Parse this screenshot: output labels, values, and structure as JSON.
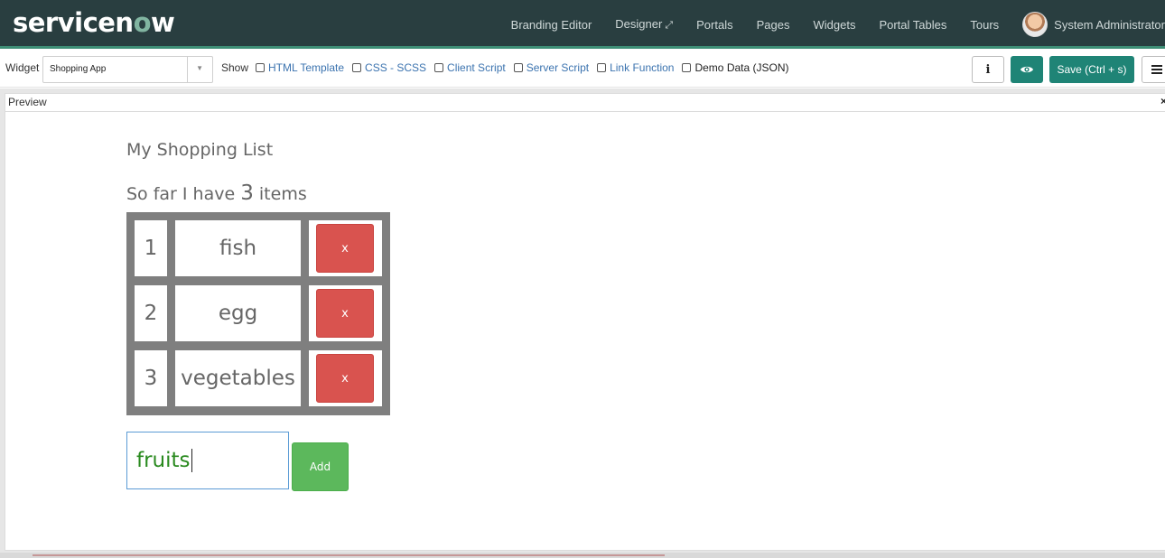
{
  "header": {
    "logo": {
      "pre": "servicen",
      "ring": "o",
      "post": "w"
    },
    "nav": [
      "Branding Editor",
      "Designer",
      "Portals",
      "Pages",
      "Widgets",
      "Portal Tables",
      "Tours"
    ],
    "designer_icon": "external-link-icon",
    "user_name": "System Administrator",
    "colors": {
      "bar": "#293e40",
      "accent": "#81b5a1"
    }
  },
  "toolbar": {
    "widget_label": "Widget",
    "widget_value": "Shopping App",
    "show_label": "Show",
    "toggles": [
      {
        "label": "HTML Template",
        "checked": false
      },
      {
        "label": "CSS - SCSS",
        "checked": false
      },
      {
        "label": "Client Script",
        "checked": false
      },
      {
        "label": "Server Script",
        "checked": false
      },
      {
        "label": "Link Function",
        "checked": false
      },
      {
        "label": "Demo Data (JSON)",
        "checked": false
      }
    ],
    "info_label": "i",
    "save_label": "Save (Ctrl + s)",
    "colors": {
      "primary": "#1f8476"
    }
  },
  "preview": {
    "title": "Preview",
    "close": "×"
  },
  "app": {
    "heading": "My Shopping List",
    "count_prefix": "So far I have",
    "count": "3",
    "count_suffix": "items",
    "items": [
      {
        "index": "1",
        "name": "fish",
        "remove_label": "x"
      },
      {
        "index": "2",
        "name": "egg",
        "remove_label": "x"
      },
      {
        "index": "3",
        "name": "vegetables",
        "remove_label": "x"
      }
    ],
    "new_item_value": "fruits",
    "add_label": "Add",
    "colors": {
      "remove": "#d9534f",
      "add": "#5cb85c",
      "input_text": "#2a8a1f"
    }
  }
}
